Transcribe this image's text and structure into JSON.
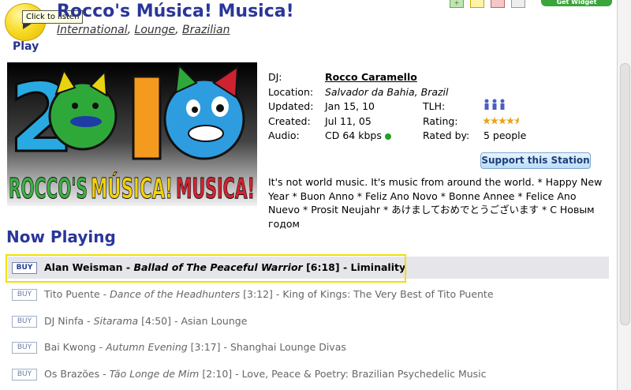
{
  "header": {
    "play_label": "Play",
    "tooltip": "Click to listen",
    "station_title": "Rocco's Música! Musica!",
    "genres": [
      "International",
      "Lounge",
      "Brazilian"
    ],
    "widget_label": "Get Widget"
  },
  "logo": {
    "year": "2010",
    "text_part1": "ROCCO'S",
    "text_part2": "MÚSICA!",
    "text_part3": "MUSICA!"
  },
  "info": {
    "dj_label": "DJ:",
    "dj_value": "Rocco Caramello",
    "location_label": "Location:",
    "location_value": "Salvador da Bahia, Brazil",
    "updated_label": "Updated:",
    "updated_value": "Jan 15, 10",
    "created_label": "Created:",
    "created_value": "Jul 11, 05",
    "audio_label": "Audio:",
    "audio_value": "CD 64 kbps",
    "tlh_label": "TLH:",
    "rating_label": "Rating:",
    "rating_value": 4.5,
    "rated_by_label": "Rated by:",
    "rated_by_value": "5 people"
  },
  "support_button": "Support this Station",
  "description": "It's not world music. It's music from around the world. * Happy New Year * Buon Anno * Feliz Ano Novo * Bonne Annee * Felice Ano Nuevo * Prosit Neujahr * あけましておめでとうございます * С Новым годом",
  "now_playing_heading": "Now Playing",
  "buy_label": "BUY",
  "tracks": [
    {
      "artist": "Alan Weisman",
      "title": "Ballad of The Peaceful Warrior",
      "duration": "[6:18]",
      "album": "Liminality"
    },
    {
      "artist": "Tito Puente",
      "title": "Dance of the Headhunters",
      "duration": "[3:12]",
      "album": "King of Kings: The Very Best of Tito Puente"
    },
    {
      "artist": "DJ Ninfa",
      "title": "Sitarama",
      "duration": "[4:50]",
      "album": "Asian Lounge"
    },
    {
      "artist": "Bai Kwong",
      "title": "Autumn Evening",
      "duration": "[3:17]",
      "album": "Shanghai Lounge Divas"
    },
    {
      "artist": "Os Brazões",
      "title": "Tão Longe de Mim",
      "duration": "[2:10]",
      "album": "Love, Peace & Poetry: Brazilian Psychedelic Music"
    }
  ],
  "colors": {
    "title_blue": "#2a3699",
    "play_yellow": "#f8dc2a",
    "highlight": "#f0e000",
    "online_green": "#22a022"
  }
}
